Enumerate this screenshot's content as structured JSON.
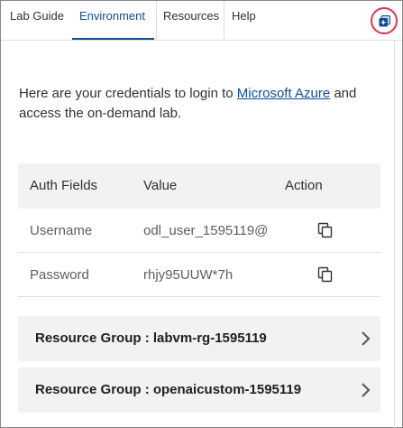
{
  "tabs": [
    {
      "label": "Lab Guide",
      "active": false
    },
    {
      "label": "Environment",
      "active": true
    },
    {
      "label": "Resources",
      "active": false
    },
    {
      "label": "Help",
      "active": false
    }
  ],
  "popout_icon": "popout-icon",
  "intro": {
    "text_before": "Here are your credentials to login to ",
    "link": "Microsoft Azure",
    "text_after": " and access the on-demand lab."
  },
  "credentials": {
    "headers": [
      "Auth Fields",
      "Value",
      "Action"
    ],
    "rows": [
      {
        "field": "Username",
        "value": "odl_user_1595119@",
        "action_icon": "copy-icon"
      },
      {
        "field": "Password",
        "value": "rhjy95UUW*7h",
        "action_icon": "copy-icon"
      }
    ]
  },
  "resource_groups": [
    {
      "label": "Resource Group : labvm-rg-1595119",
      "icon": "chevron-right-icon"
    },
    {
      "label": "Resource Group : openaicustom-1595119",
      "icon": "chevron-right-icon"
    }
  ],
  "colors": {
    "accent": "#0f4c9c",
    "highlight_circle": "#e0344d",
    "panel": "#f3f2f1"
  }
}
